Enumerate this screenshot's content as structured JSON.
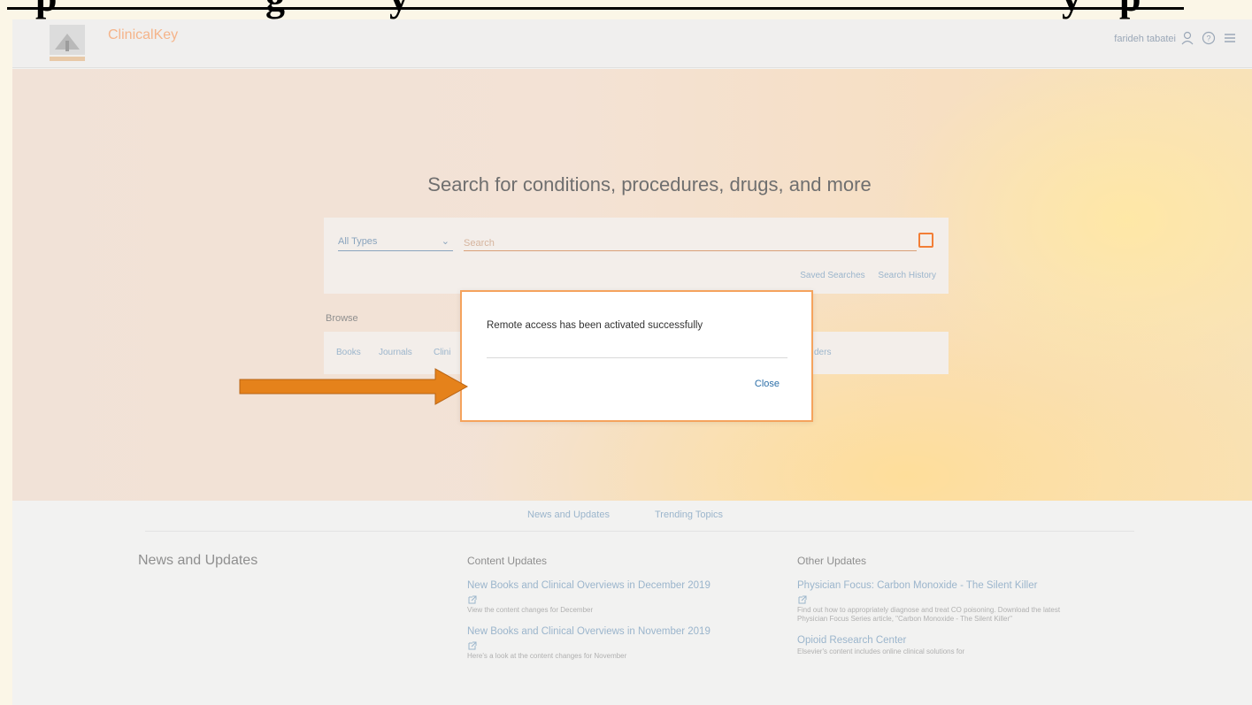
{
  "header": {
    "brand": "ClinicalKey",
    "user_name": "farideh tabatei",
    "icons": [
      "user-icon",
      "help-icon",
      "menu-icon"
    ]
  },
  "hero": {
    "title": "Search for conditions, procedures, drugs, and more"
  },
  "search": {
    "type_selected": "All Types",
    "placeholder": "Search",
    "saved_searches": "Saved Searches",
    "search_history": "Search History"
  },
  "browse": {
    "label": "Browse",
    "items": [
      "Books",
      "Journals",
      "Clini",
      "ders"
    ]
  },
  "dialog": {
    "message": "Remote access has been activated successfully",
    "close_label": "Close"
  },
  "tabs": [
    "News and Updates",
    "Trending Topics"
  ],
  "news": {
    "title": "News and Updates",
    "content_updates": {
      "title": "Content Updates",
      "items": [
        {
          "link": "New Books and Clinical Overviews in December 2019",
          "desc": "View the content changes for December"
        },
        {
          "link": "New Books and Clinical Overviews in November 2019",
          "desc": "Here's a look at the content changes for November"
        }
      ]
    },
    "other_updates": {
      "title": "Other Updates",
      "items": [
        {
          "link": "Physician Focus: Carbon Monoxide - The Silent Killer",
          "desc": "Find out how to appropriately diagnose and treat CO poisoning. Download the latest Physician Focus Series article, \"Carbon Monoxide - The Silent Killer\""
        },
        {
          "link": "Opioid Research Center",
          "desc": "Elsevier's content includes online clinical solutions for"
        }
      ]
    }
  },
  "colors": {
    "accent": "#f27e36",
    "link": "#9bb5cc",
    "dialog_border": "#f5a35d",
    "arrow": "#e5821b"
  }
}
